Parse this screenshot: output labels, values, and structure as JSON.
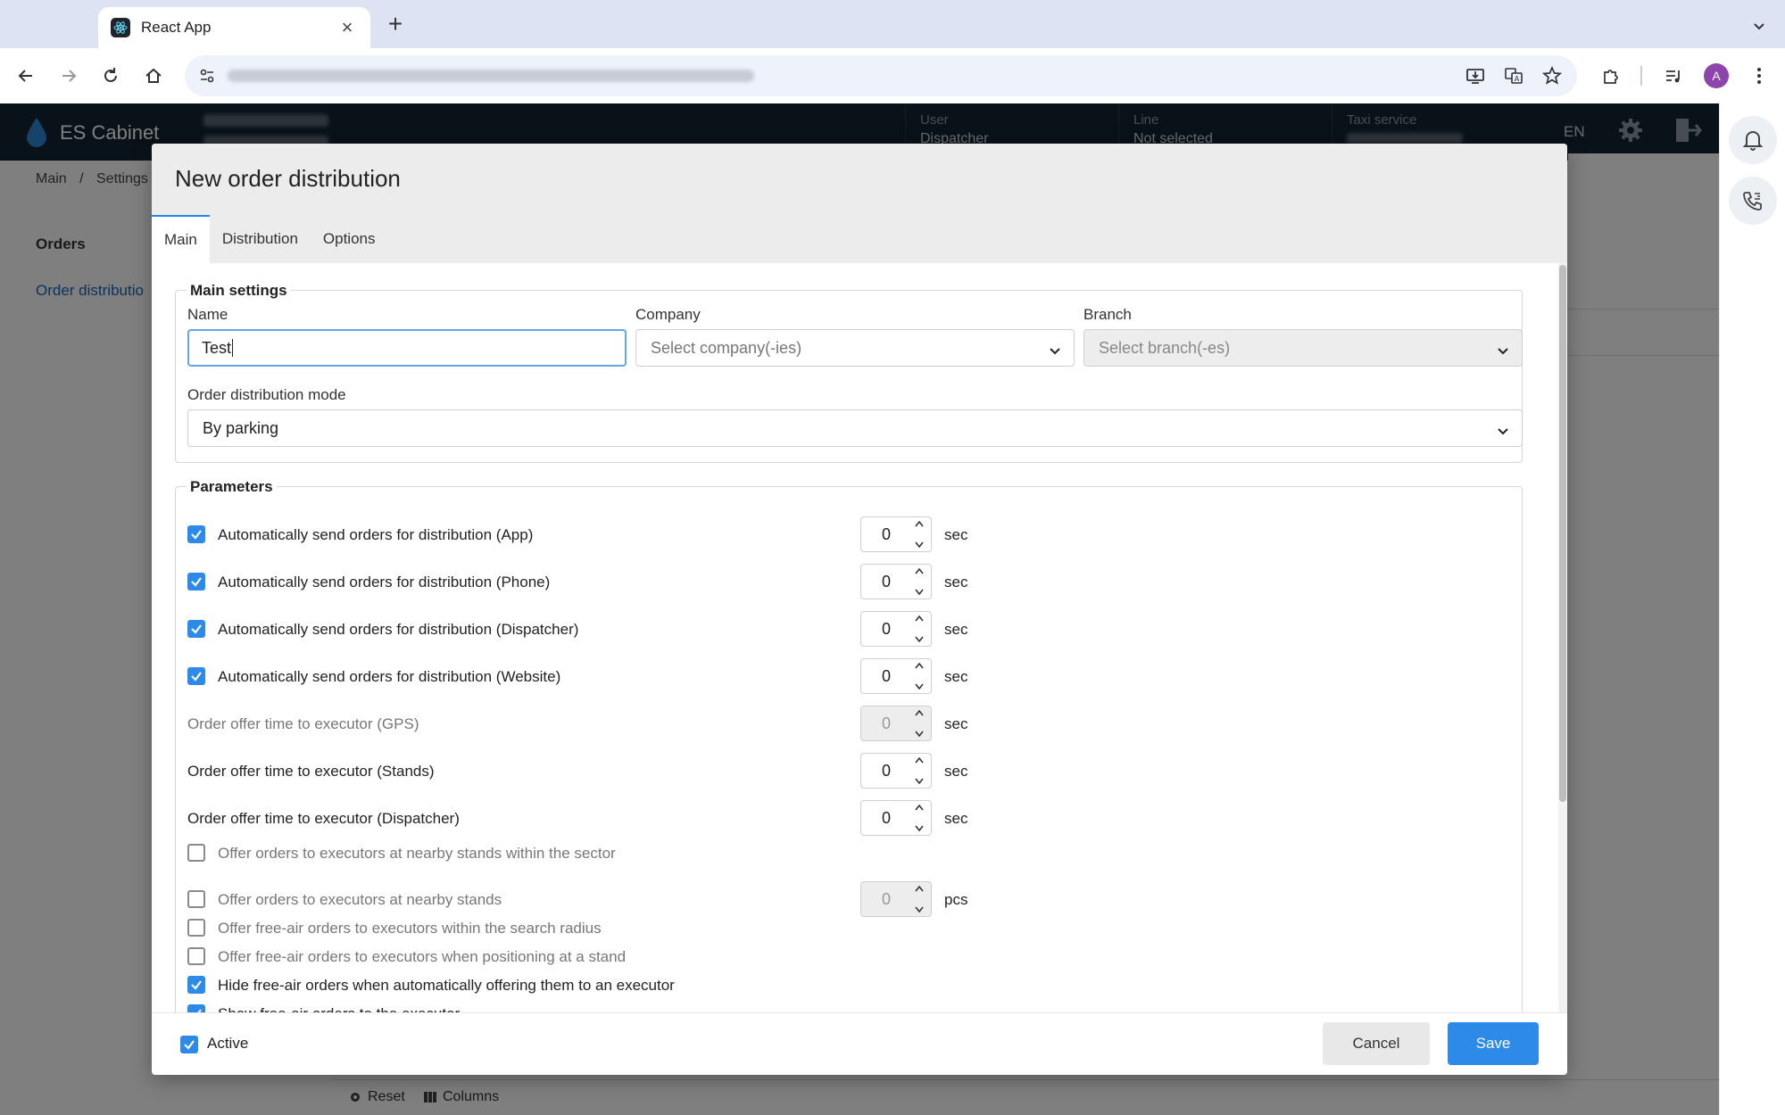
{
  "browser": {
    "tab_title": "React App",
    "tab_icons": [
      "react-favicon-icon",
      "close-icon",
      "plus-icon",
      "chevron-down-icon"
    ],
    "toolbar_icons": [
      "back-icon",
      "forward-icon",
      "reload-icon",
      "home-icon",
      "site-info-icon",
      "install-icon",
      "translate-icon",
      "star-icon",
      "extensions-icon",
      "media-icon",
      "kebab-menu-icon"
    ],
    "profile_initial": "A"
  },
  "app": {
    "brand": "ES Cabinet",
    "header": {
      "user_label": "User",
      "user_value": "Dispatcher",
      "line_label": "Line",
      "line_value": "Not selected",
      "taxi_label": "Taxi service",
      "lang": "EN"
    },
    "breadcrumb": [
      "Main",
      "/",
      "Settings"
    ],
    "sidebar": {
      "section": "Orders",
      "active_item": "Order distributio"
    },
    "bottom_bar": {
      "reset": "Reset",
      "columns": "Columns"
    }
  },
  "modal": {
    "title": "New order distribution",
    "tabs": [
      {
        "label": "Main",
        "active": true
      },
      {
        "label": "Distribution",
        "active": false
      },
      {
        "label": "Options",
        "active": false
      }
    ],
    "main_settings": {
      "legend": "Main settings",
      "name_label": "Name",
      "name_value": "Test",
      "company_label": "Company",
      "company_placeholder": "Select company(-ies)",
      "branch_label": "Branch",
      "branch_placeholder": "Select branch(-es)",
      "mode_label": "Order distribution mode",
      "mode_value": "By parking"
    },
    "parameters": {
      "legend": "Parameters",
      "rows": [
        {
          "label": "Automatically send orders for distribution (App)",
          "checkbox": true,
          "checked": true,
          "value": "0",
          "unit": "sec",
          "disabled": false
        },
        {
          "label": "Automatically send orders for distribution (Phone)",
          "checkbox": true,
          "checked": true,
          "value": "0",
          "unit": "sec",
          "disabled": false
        },
        {
          "label": "Automatically send orders for distribution (Dispatcher)",
          "checkbox": true,
          "checked": true,
          "value": "0",
          "unit": "sec",
          "disabled": false
        },
        {
          "label": "Automatically send orders for distribution (Website)",
          "checkbox": true,
          "checked": true,
          "value": "0",
          "unit": "sec",
          "disabled": false
        },
        {
          "label": "Order offer time to executor (GPS)",
          "checkbox": false,
          "value": "0",
          "unit": "sec",
          "disabled": true
        },
        {
          "label": "Order offer time to executor (Stands)",
          "checkbox": false,
          "value": "0",
          "unit": "sec",
          "disabled": false
        },
        {
          "label": "Order offer time to executor (Dispatcher)",
          "checkbox": false,
          "value": "0",
          "unit": "sec",
          "disabled": false
        },
        {
          "label": "Offer orders to executors at nearby stands within the sector",
          "checkbox": true,
          "checked": false
        },
        {
          "label": "Offer orders to executors at nearby stands",
          "checkbox": true,
          "checked": false,
          "value": "0",
          "unit": "pcs",
          "disabled": true
        },
        {
          "label": "Offer free-air orders to executors within the search radius",
          "checkbox": true,
          "checked": false
        },
        {
          "label": "Offer free-air orders to executors when positioning at a stand",
          "checkbox": true,
          "checked": false
        },
        {
          "label": "Hide free-air orders when automatically offering them to an executor",
          "checkbox": true,
          "checked": true
        },
        {
          "label": "Show free-air orders to the executor",
          "checkbox": true,
          "checked": true
        }
      ]
    },
    "footer": {
      "active_label": "Active",
      "active_checked": true,
      "cancel": "Cancel",
      "save": "Save"
    }
  },
  "colors": {
    "accent": "#2d8ae8",
    "header_bg": "#142433",
    "overlay": "rgba(0,0,0,0.5)"
  }
}
